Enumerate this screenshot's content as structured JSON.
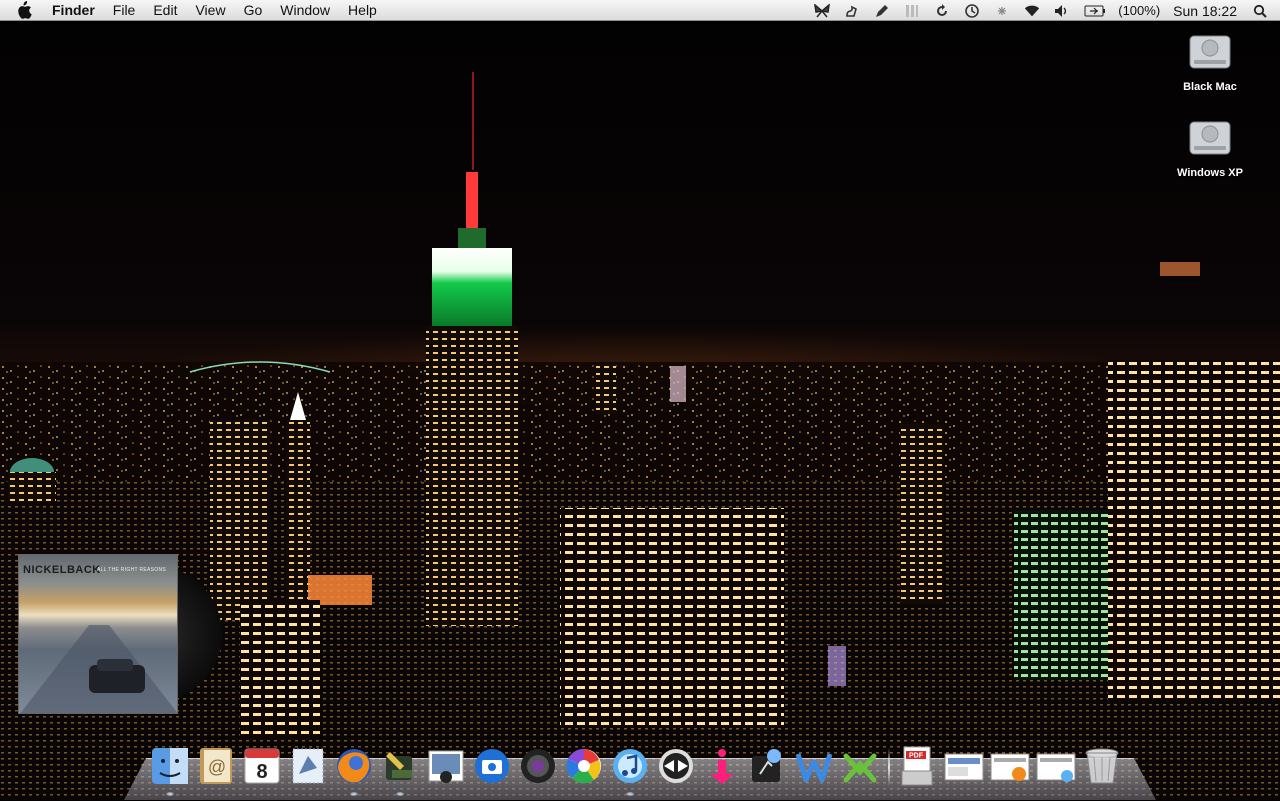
{
  "menubar": {
    "app_name": "Finder",
    "menus": [
      "File",
      "Edit",
      "View",
      "Go",
      "Window",
      "Help"
    ],
    "status": {
      "battery_percent": "(100%)",
      "clock": "Sun 18:22"
    },
    "status_icons": [
      "butterfly-icon",
      "gesture-icon",
      "pencil-icon",
      "grip-icon",
      "sync-icon",
      "time-machine-icon",
      "bluetooth-icon",
      "wifi-icon",
      "volume-icon",
      "battery-icon",
      "spotlight-icon"
    ]
  },
  "desktop": {
    "drives": [
      {
        "label": "Black Mac",
        "icon": "hard-drive-icon"
      },
      {
        "label": "Windows XP",
        "icon": "hard-drive-icon"
      }
    ],
    "wallpaper": "night-city-skyline"
  },
  "album_widget": {
    "band": "NICKELBACK",
    "album": "ALL THE RIGHT REASONS"
  },
  "dock": {
    "apps": [
      {
        "name": "finder",
        "icon": "finder-icon",
        "running": true
      },
      {
        "name": "address-book",
        "icon": "address-book-icon",
        "running": false
      },
      {
        "name": "ical",
        "icon": "calendar-icon",
        "running": false,
        "calendar_day": "8"
      },
      {
        "name": "mail",
        "icon": "mail-stamp-icon",
        "running": false
      },
      {
        "name": "firefox",
        "icon": "firefox-icon",
        "running": true
      },
      {
        "name": "pencil-app",
        "icon": "pencil-app-icon",
        "running": true
      },
      {
        "name": "iphoto",
        "icon": "iphoto-icon",
        "running": false
      },
      {
        "name": "camera",
        "icon": "camera-icon",
        "running": false
      },
      {
        "name": "aperture",
        "icon": "aperture-icon",
        "running": false
      },
      {
        "name": "picasa",
        "icon": "picasa-icon",
        "running": false
      },
      {
        "name": "itunes",
        "icon": "itunes-icon",
        "running": true
      },
      {
        "name": "adium",
        "icon": "bowtie-icon",
        "running": false
      },
      {
        "name": "istat",
        "icon": "info-i-icon",
        "running": false
      },
      {
        "name": "disk-tool",
        "icon": "disk-tool-icon",
        "running": false
      },
      {
        "name": "word",
        "icon": "word-icon",
        "running": false
      },
      {
        "name": "messenger",
        "icon": "messenger-icon",
        "running": false
      }
    ],
    "docs": [
      {
        "name": "pdf-stack",
        "icon": "pdf-stack-icon"
      },
      {
        "name": "screenshot-stack",
        "icon": "screenshot-stack-icon"
      },
      {
        "name": "firefox-stack",
        "icon": "firefox-stack-icon"
      },
      {
        "name": "music-stack",
        "icon": "music-stack-icon"
      },
      {
        "name": "trash",
        "icon": "trash-icon"
      }
    ],
    "pdf_label": "PDF"
  }
}
